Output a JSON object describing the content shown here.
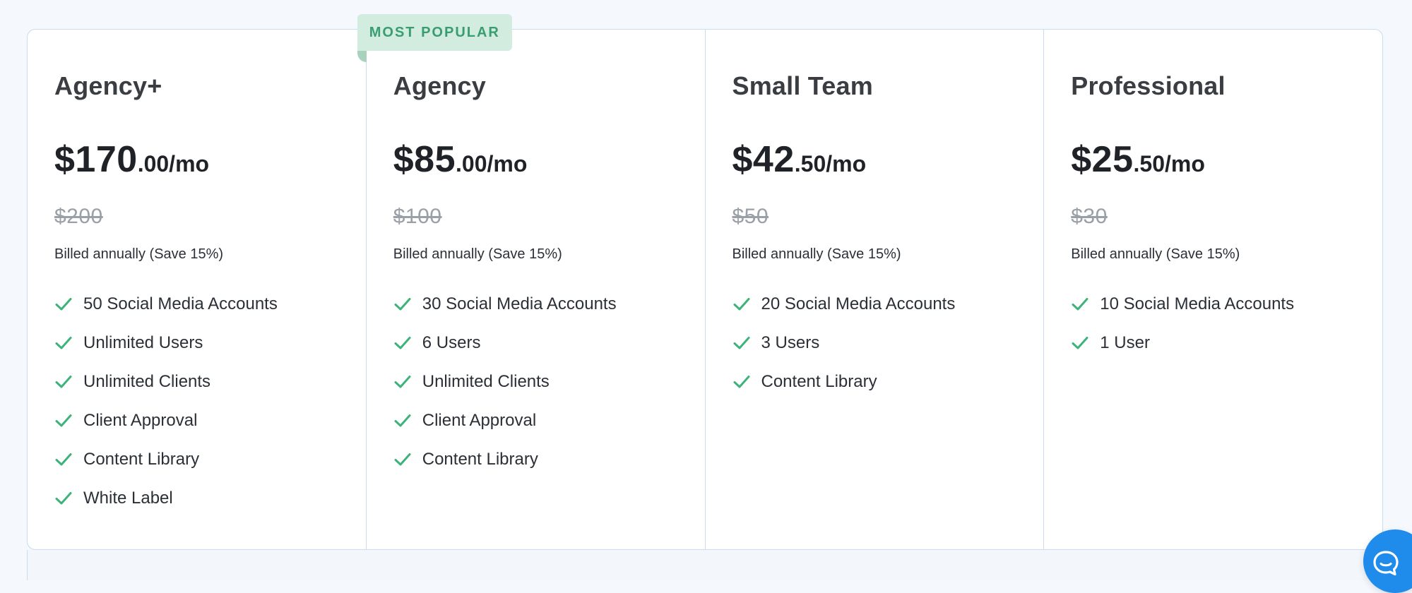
{
  "badge": {
    "label": "MOST POPULAR"
  },
  "plans": [
    {
      "name": "Agency+",
      "price_main": "$170",
      "price_cents": ".00",
      "price_period": "/mo",
      "old_price": "$200",
      "billing_note": "Billed annually (Save 15%)",
      "features": [
        "50 Social Media Accounts",
        "Unlimited Users",
        "Unlimited Clients",
        "Client Approval",
        "Content Library",
        "White Label"
      ]
    },
    {
      "name": "Agency",
      "price_main": "$85",
      "price_cents": ".00",
      "price_period": "/mo",
      "old_price": "$100",
      "billing_note": "Billed annually (Save 15%)",
      "features": [
        "30 Social Media Accounts",
        "6 Users",
        "Unlimited Clients",
        "Client Approval",
        "Content Library"
      ]
    },
    {
      "name": "Small Team",
      "price_main": "$42",
      "price_cents": ".50",
      "price_period": "/mo",
      "old_price": "$50",
      "billing_note": "Billed annually (Save 15%)",
      "features": [
        "20 Social Media Accounts",
        "3 Users",
        "Content Library"
      ]
    },
    {
      "name": "Professional",
      "price_main": "$25",
      "price_cents": ".50",
      "price_period": "/mo",
      "old_price": "$30",
      "billing_note": "Billed annually (Save 15%)",
      "features": [
        "10 Social Media Accounts",
        "1 User"
      ]
    }
  ],
  "icons": {
    "feature": "check-icon",
    "chat": "chat-bubble-icon"
  },
  "colors": {
    "accent_green": "#3bb37a",
    "badge_bg": "#d3ece0",
    "badge_text": "#3a9d70",
    "chat_blue": "#1f8ceb",
    "border": "#c9dcf2"
  }
}
